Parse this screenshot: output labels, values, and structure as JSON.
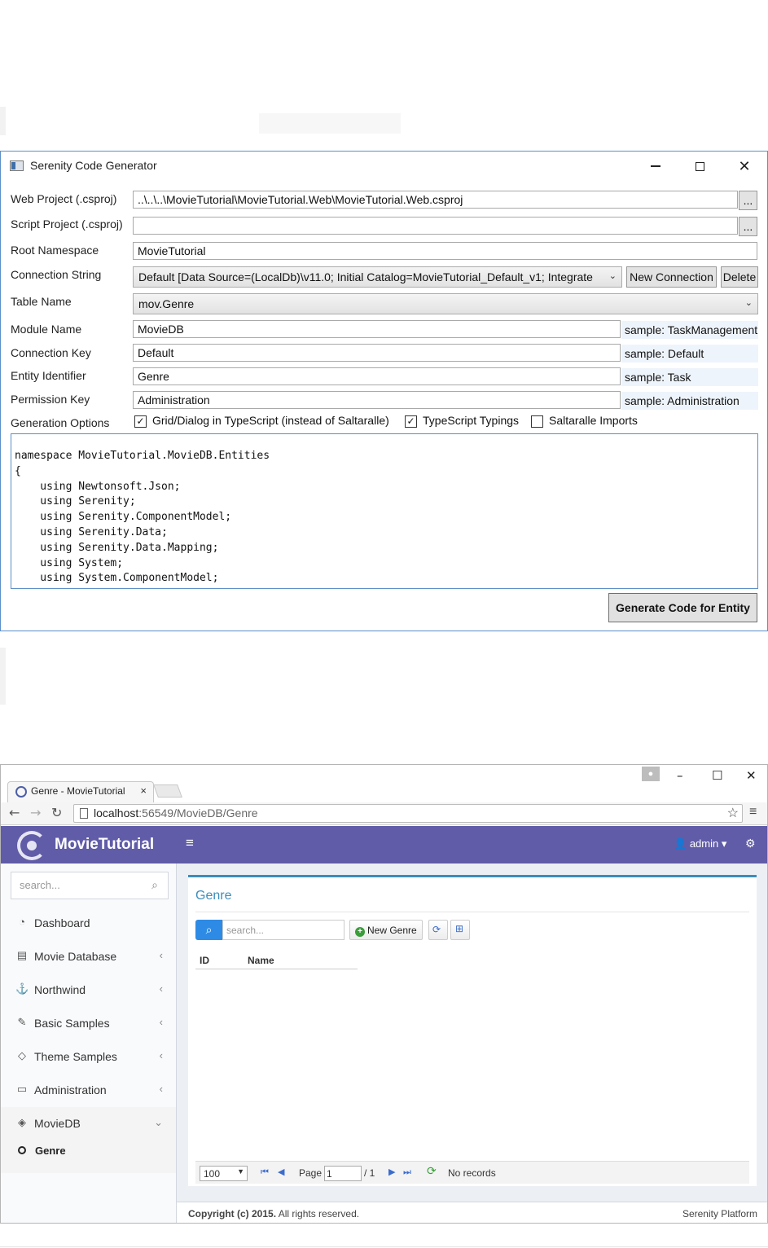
{
  "generator": {
    "window_title": "Serenity Code Generator",
    "fields": {
      "web_project": {
        "label": "Web Project (.csproj)",
        "value": "..\\..\\..\\MovieTutorial\\MovieTutorial.Web\\MovieTutorial.Web.csproj",
        "browse": "..."
      },
      "script_project": {
        "label": "Script Project (.csproj)",
        "value": "",
        "browse": "..."
      },
      "root_namespace": {
        "label": "Root Namespace",
        "value": "MovieTutorial"
      },
      "connection_string": {
        "label": "Connection String",
        "value": "Default [Data Source=(LocalDb)\\v11.0; Initial Catalog=MovieTutorial_Default_v1; Integrate",
        "new_label": "New Connection",
        "delete_label": "Delete"
      },
      "table_name": {
        "label": "Table Name",
        "value": "mov.Genre"
      },
      "module_name": {
        "label": "Module Name",
        "value": "MovieDB",
        "sample": "sample: TaskManagement"
      },
      "connection_key": {
        "label": "Connection Key",
        "value": "Default",
        "sample": "sample: Default"
      },
      "entity_identifier": {
        "label": "Entity Identifier",
        "value": "Genre",
        "sample": "sample: Task"
      },
      "permission_key": {
        "label": "Permission Key",
        "value": "Administration",
        "sample": "sample: Administration"
      }
    },
    "generation_options": {
      "label": "Generation Options",
      "options": [
        {
          "label": "Grid/Dialog in TypeScript (instead of Saltaralle)",
          "checked": true
        },
        {
          "label": "TypeScript Typings",
          "checked": true
        },
        {
          "label": "Saltaralle Imports",
          "checked": false
        }
      ]
    },
    "code_lines": [
      "namespace MovieTutorial.MovieDB.Entities",
      "{",
      "    using Newtonsoft.Json;",
      "    using Serenity;",
      "    using Serenity.ComponentModel;",
      "    using Serenity.Data;",
      "    using Serenity.Data.Mapping;",
      "    using System;",
      "    using System.ComponentModel;"
    ],
    "generate_label": "Generate Code for Entity"
  },
  "browser": {
    "tab_title": "Genre - MovieTutorial",
    "tab_close": "×",
    "url_host": "localhost",
    "url_rest": ":56549/MovieDB/Genre",
    "app": {
      "brand": "MovieTutorial",
      "user": "admin",
      "sidebar": {
        "search_placeholder": "search...",
        "items": [
          {
            "label": "Dashboard",
            "icon": "dashboard-icon",
            "glyph": "◔",
            "caret": ""
          },
          {
            "label": "Movie Database",
            "icon": "film-icon",
            "glyph": "▤",
            "caret": "‹"
          },
          {
            "label": "Northwind",
            "icon": "anchor-icon",
            "glyph": "⚓",
            "caret": "‹"
          },
          {
            "label": "Basic Samples",
            "icon": "magic-icon",
            "glyph": "✎",
            "caret": "‹"
          },
          {
            "label": "Theme Samples",
            "icon": "diamond-icon",
            "glyph": "◇",
            "caret": "‹"
          },
          {
            "label": "Administration",
            "icon": "desktop-icon",
            "glyph": "▭",
            "caret": "‹"
          },
          {
            "label": "MovieDB",
            "icon": "layers-icon",
            "glyph": "◈",
            "caret": "⌄"
          }
        ],
        "sub_item": "Genre"
      },
      "page": {
        "title": "Genre",
        "search_placeholder": "search...",
        "new_button": "New Genre",
        "columns": [
          "ID",
          "Name"
        ],
        "pager": {
          "page_size": "100",
          "page_label": "Page",
          "page_value": "1",
          "page_total": "/ 1",
          "status": "No records"
        }
      },
      "footer": {
        "copyright": "Copyright (c) 2015.",
        "rights": " All rights reserved.",
        "platform": "Serenity Platform"
      }
    }
  }
}
